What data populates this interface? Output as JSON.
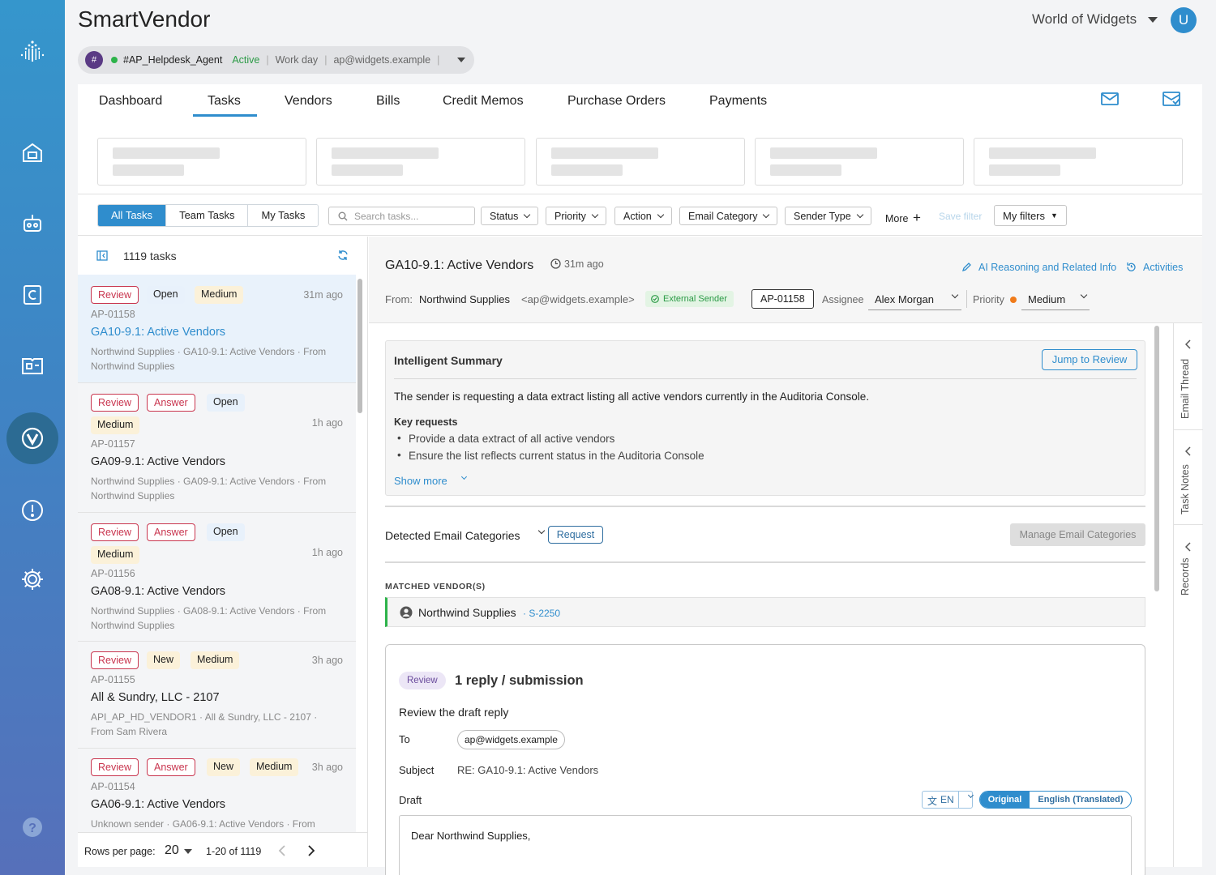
{
  "app": {
    "name": "SmartVendor",
    "org": "World of Widgets",
    "avatar_letter": "U"
  },
  "agent": {
    "hash": "#",
    "name": "#AP_Helpdesk_Agent",
    "status": "Active",
    "schedule": "Work day",
    "email": "ap@widgets.example",
    "sep": "|"
  },
  "nav": {
    "tabs": [
      "Dashboard",
      "Tasks",
      "Vendors",
      "Bills",
      "Credit Memos",
      "Purchase Orders",
      "Payments"
    ],
    "active": "Tasks"
  },
  "filters": {
    "segments": [
      "All Tasks",
      "Team Tasks",
      "My Tasks"
    ],
    "search_placeholder": "Search tasks...",
    "dropdowns": [
      "Status",
      "Priority",
      "Action",
      "Email Category",
      "Sender Type"
    ],
    "more": "More",
    "save_filter": "Save filter",
    "my_filters": "My filters"
  },
  "list": {
    "count": "1119 tasks",
    "items": [
      {
        "badges": [
          "Review",
          "Open",
          "Medium"
        ],
        "ago": "31m ago",
        "id": "AP-01158",
        "title": "GA10-9.1: Active Vendors",
        "sub": "Northwind Supplies · GA10-9.1: Active Vendors · From Northwind Supplies"
      },
      {
        "badges": [
          "Review",
          "Answer",
          "Open",
          "Medium"
        ],
        "ago": "1h ago",
        "id": "AP-01157",
        "title": "GA09-9.1: Active Vendors",
        "sub": "Northwind Supplies · GA09-9.1: Active Vendors · From Northwind Supplies"
      },
      {
        "badges": [
          "Review",
          "Answer",
          "Open",
          "Medium"
        ],
        "ago": "1h ago",
        "id": "AP-01156",
        "title": "GA08-9.1: Active Vendors",
        "sub": "Northwind Supplies · GA08-9.1: Active Vendors · From Northwind Supplies"
      },
      {
        "badges": [
          "Review",
          "New",
          "Medium"
        ],
        "ago": "3h ago",
        "id": "AP-01155",
        "title": "All & Sundry, LLC - 2107",
        "sub": "API_AP_HD_VENDOR1 · All & Sundry, LLC - 2107 · From Sam Rivera"
      },
      {
        "badges": [
          "Review",
          "Answer",
          "New",
          "Medium"
        ],
        "ago": "3h ago",
        "id": "AP-01154",
        "title": "GA06-9.1: Active Vendors",
        "sub": "Unknown sender · GA06-9.1: Active Vendors · From"
      }
    ]
  },
  "pager": {
    "label": "Rows per page:",
    "rows": "20",
    "range": "1-20 of 1119"
  },
  "task": {
    "title": "GA10-9.1: Active Vendors",
    "ago": "31m ago",
    "ai_link": "AI Reasoning and Related Info",
    "activities": "Activities",
    "from_label": "From:",
    "from_name": "Northwind Supplies",
    "from_email": "<ap@widgets.example>",
    "sender_tag": "External Sender",
    "id": "AP-01158",
    "assignee_label": "Assignee",
    "assignee": "Alex Morgan",
    "priority_label": "Priority",
    "priority": "Medium",
    "priority_color": "#f07b1a"
  },
  "side_tabs": [
    "Email Thread",
    "Task Notes",
    "Records"
  ],
  "summary": {
    "heading": "Intelligent Summary",
    "jump": "Jump to Review",
    "text": "The sender is requesting a data extract listing all active vendors currently in the Auditoria Console.",
    "key_label": "Key requests",
    "bullets": [
      "Provide a data extract of all active vendors",
      "Ensure the list reflects current status in the Auditoria Console"
    ],
    "show_more": "Show more"
  },
  "categories": {
    "label": "Detected Email Categories",
    "tag": "Request",
    "manage": "Manage Email Categories"
  },
  "vendors": {
    "label": "MATCHED VENDOR(S)",
    "name": "Northwind Supplies",
    "code": "· S-2250"
  },
  "reply": {
    "badge": "Review",
    "heading": "1 reply / submission",
    "subheading": "Review the draft reply",
    "to_label": "To",
    "to": "ap@widgets.example",
    "subject_label": "Subject",
    "subject": "RE: GA10-9.1: Active Vendors",
    "draft_label": "Draft",
    "lang": "EN",
    "toggle": [
      "Original",
      "English (Translated)"
    ],
    "body": "Dear Northwind Supplies,"
  },
  "colors": {
    "accent": "#2f8dcd",
    "review": "#c9364f",
    "active": "#2db34a"
  }
}
